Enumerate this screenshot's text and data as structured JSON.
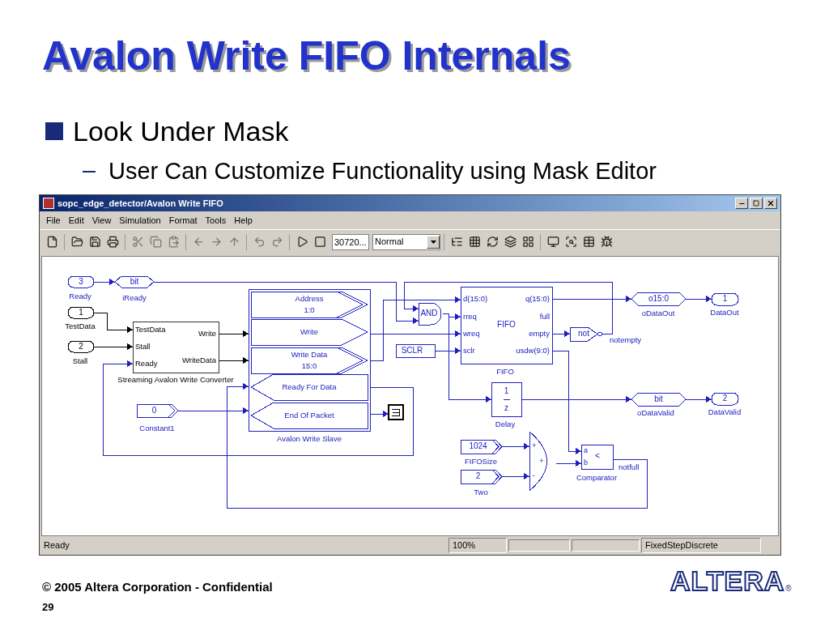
{
  "slide": {
    "title": "Avalon Write FIFO Internals",
    "bullets": [
      {
        "text": "Look Under Mask",
        "children": [
          {
            "text": "User Can Customize Functionality using Mask Editor"
          }
        ]
      }
    ],
    "footer": "© 2005 Altera Corporation - Confidential",
    "page": "29",
    "logo": "ALTERA",
    "logo_mark": "®"
  },
  "window": {
    "title": "sopc_edge_detector/Avalon Write FIFO",
    "menu": [
      "File",
      "Edit",
      "View",
      "Simulation",
      "Format",
      "Tools",
      "Help"
    ],
    "toolbar": {
      "stop_time": "30720...",
      "mode": "Normal"
    },
    "diagram": {
      "blocks": [
        {
          "kind": "inport",
          "text": "3",
          "caption": "Ready",
          "color": "#2020c0"
        },
        {
          "kind": "tag",
          "text": "bit",
          "caption": "iReady",
          "color": "#2020c0"
        },
        {
          "kind": "inport",
          "text": "1",
          "caption": "TestData",
          "color": "#000000"
        },
        {
          "kind": "inport",
          "text": "2",
          "caption": "Stall",
          "color": "#000000"
        },
        {
          "kind": "subsystem",
          "inputs": [
            "TestData",
            "Stall",
            "Ready"
          ],
          "outputs": [
            "Write",
            "WriteData"
          ],
          "caption": "Streaming Avalon Write Converter",
          "color": "#000000"
        },
        {
          "kind": "constant",
          "text": "0",
          "caption": "Constant1",
          "color": "#2020c0"
        },
        {
          "kind": "slave",
          "rows": [
            {
              "lines": [
                "Address",
                "1:0"
              ],
              "kind": "output"
            },
            {
              "lines": [
                "Write"
              ],
              "kind": "output"
            },
            {
              "lines": [
                "Write Data",
                "15:0"
              ],
              "kind": "output"
            },
            {
              "lines": [
                "Ready For Data"
              ],
              "kind": "input"
            },
            {
              "lines": [
                "End Of Packet"
              ],
              "kind": "input"
            }
          ],
          "caption": "Avalon Write Slave",
          "color": "#2020c0"
        },
        {
          "kind": "terminator",
          "color": "#000000"
        },
        {
          "kind": "gate",
          "text": "AND",
          "color": "#2020c0"
        },
        {
          "kind": "from",
          "text": "SCLR",
          "color": "#2020c0"
        },
        {
          "kind": "fifo",
          "inputs": [
            "d(15:0)",
            "rreq",
            "wreq",
            "sclr"
          ],
          "outputs": [
            "q(15:0)",
            "full",
            "empty",
            "usdw(9:0)"
          ],
          "text": "FIFO",
          "caption": "FIFO",
          "color": "#2020c0"
        },
        {
          "kind": "inverter",
          "text": "not",
          "color": "#2020c0"
        },
        {
          "kind": "tag",
          "text": "o15:0",
          "caption": "oDataOut",
          "color": "#2020c0"
        },
        {
          "kind": "outport",
          "text": "1",
          "caption": "DataOut",
          "color": "#2020c0"
        },
        {
          "kind": "delay",
          "lines": [
            "1",
            "z"
          ],
          "caption": "Delay",
          "color": "#2020c0"
        },
        {
          "kind": "tag",
          "text": "bit",
          "caption": "oDataValid",
          "color": "#2020c0"
        },
        {
          "kind": "outport",
          "text": "2",
          "caption": "DataValid",
          "color": "#2020c0"
        },
        {
          "kind": "constant",
          "text": "1024",
          "caption": "FIFOSize",
          "color": "#2020c0"
        },
        {
          "kind": "constant",
          "text": "2",
          "caption": "Two",
          "color": "#2020c0"
        },
        {
          "kind": "sum",
          "signs": [
            "+",
            "+",
            "-"
          ],
          "color": "#2020c0"
        },
        {
          "kind": "comparator",
          "inputs": [
            "a",
            "b"
          ],
          "text": "<",
          "caption": "Comparator",
          "color": "#2020c0"
        }
      ],
      "signal_labels": [
        "notempty",
        "notfull"
      ]
    },
    "status_bar": [
      "Ready",
      "100%",
      "FixedStepDiscrete"
    ]
  }
}
